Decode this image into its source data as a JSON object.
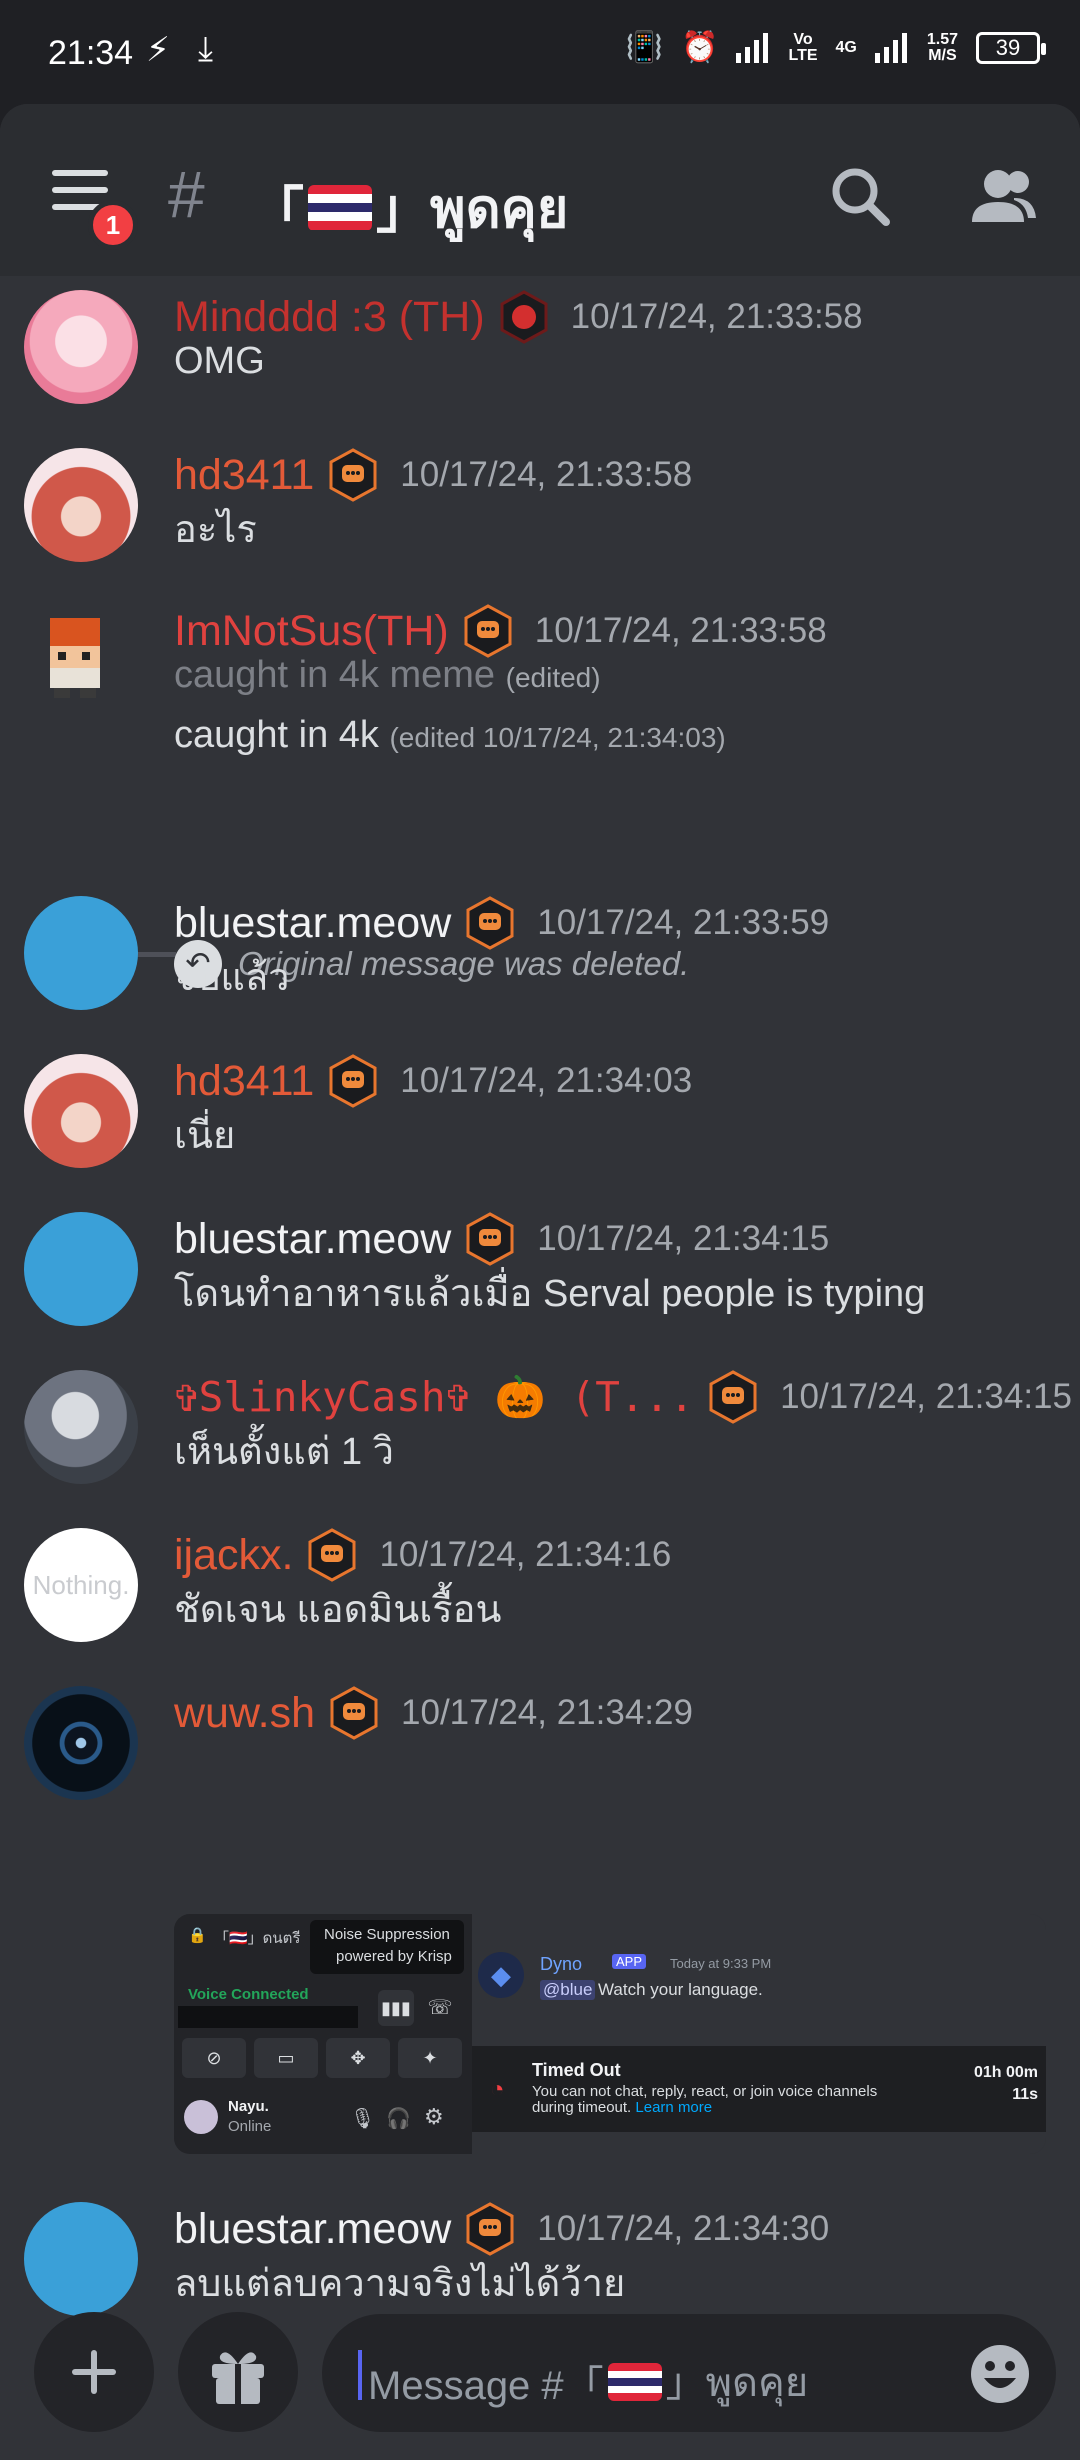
{
  "status": {
    "time": "21:34",
    "net_speed_top": "1.57",
    "net_speed_bottom": "M/S",
    "net_type_top": "Vo",
    "net_type_bottom": "LTE",
    "net_4g": "4G",
    "battery": "39"
  },
  "header": {
    "notification_count": "1",
    "channel_prefix": "「",
    "channel_suffix": "」พูดคุย"
  },
  "colors": {
    "accent": "#5865f2",
    "red_name": "#e0423f",
    "orange_name": "#e35a38",
    "white_name": "#f2f3f5",
    "badge": "#f23f43"
  },
  "reply": {
    "text": "Original message was deleted."
  },
  "messages": [
    {
      "user": "Mindddd :3 (TH)",
      "time": "10/17/24, 21:33:58",
      "text": "OMG"
    },
    {
      "user": "hd3411",
      "time": "10/17/24, 21:33:58",
      "text": "อะไร"
    },
    {
      "user": "ImNotSus(TH)",
      "time": "10/17/24, 21:33:58",
      "text": "caught in 4k meme",
      "edited": "(edited)",
      "text2": "caught in 4k",
      "edited2": "(edited 10/17/24, 21:34:03)"
    },
    {
      "user": "bluestar.meow",
      "time": "10/17/24, 21:33:59",
      "text": "จบแล้ว"
    },
    {
      "user": "hd3411",
      "time": "10/17/24, 21:34:03",
      "text": "เนี่ย"
    },
    {
      "user": "bluestar.meow",
      "time": "10/17/24, 21:34:15",
      "text": "โดนทำอาหารแล้วเมื่อ Serval people is typing"
    },
    {
      "user": "✞SlinkyCash✞ 🎃 (T...",
      "time": "10/17/24, 21:34:15",
      "text": "เห็นตั้งแต่ 1 วิ"
    },
    {
      "user": "ijackx.",
      "time": "10/17/24, 21:34:16",
      "text": "ชัดเจน แอดมินเรื้อน",
      "avatar_text": "Nothing."
    },
    {
      "user": "wuw.sh",
      "time": "10/17/24, 21:34:29",
      "text": ""
    },
    {
      "user": "bluestar.meow",
      "time": "10/17/24, 21:34:30",
      "text": "ลบแต่ลบความจริงไม่ได้ว้าย"
    }
  ],
  "attachment": {
    "channel": "「🇹🇭」ดนตรี",
    "noise_suppression": "Noise Suppression",
    "powered_by": "powered by Krisp",
    "voice_connected": "Voice Connected",
    "user_name": "Nayu.",
    "user_status": "Online",
    "bot_name": "Dyno",
    "bot_tag": "APP",
    "bot_time": "Today at 9:33 PM",
    "bot_mention": "@blue",
    "bot_text": "Watch your language.",
    "timeout_title": "Timed Out",
    "timeout_text": "You can not chat, reply, react, or join voice channels during timeout.",
    "learn_more": "Learn more",
    "timeout_remaining_1": "01h 00m",
    "timeout_remaining_2": "11s"
  },
  "input": {
    "placeholder_prefix": "Message #「",
    "placeholder_suffix": "」พูดคุย"
  }
}
